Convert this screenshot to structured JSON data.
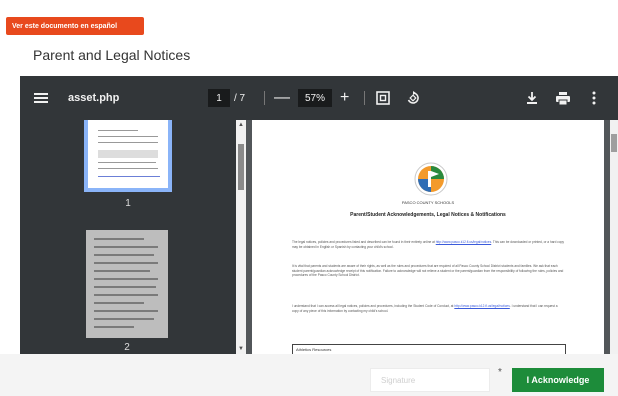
{
  "language_button": "Ver este documento en español",
  "page_title": "Parent and Legal Notices",
  "viewer": {
    "filename": "asset.php",
    "current_page": "1",
    "page_count": "/ 7",
    "zoom": "57%",
    "minus": "—",
    "plus": "+"
  },
  "thumbnails": [
    {
      "label": "1"
    },
    {
      "label": "2"
    }
  ],
  "document": {
    "org": "PASCO COUNTY SCHOOLS",
    "title": "Parent/Student Acknowledgements, Legal Notices & Notifications",
    "paragraphs": [
      {
        "text": "The legal notices, policies and procedures listed and described can be found in their entirety online at",
        "link": "http://www.pasco.k12.fl.us/legal/notices",
        "text2": ". This can be downloaded or printed, or a hard copy may be obtained in English or Spanish by contacting your child's school."
      },
      {
        "text": "It is vital that parents and students are aware of their rights, as well as the rules and procedures that are required of all Pasco County School District students and families. We ask that each student parent/guardian acknowledge receipt of this notification. Failure to acknowledge will not relieve a student or the parent/guardian from the responsibility of following the rules, policies and procedures of the Pasco County School District.",
        "link": "",
        "text2": ""
      },
      {
        "text": "I understand that I can access all legal notices, policies and procedures, including the Student Code of Conduct, at",
        "link": "http://www.pasco.k12.fl.us/legal/notices",
        "text2": ". I understand that I can request a copy of any piece of this information by contacting my child's school."
      }
    ],
    "box_label": "Athletics Resources"
  },
  "footer": {
    "signature_placeholder": "Signature",
    "required_mark": "*",
    "acknowledge_label": "I Acknowledge"
  },
  "colors": {
    "language_button": "#e8491d",
    "acknowledge_button": "#1d8c3a",
    "viewer_toolbar": "#323639",
    "thumbnail_highlight": "#8ab4f8"
  }
}
